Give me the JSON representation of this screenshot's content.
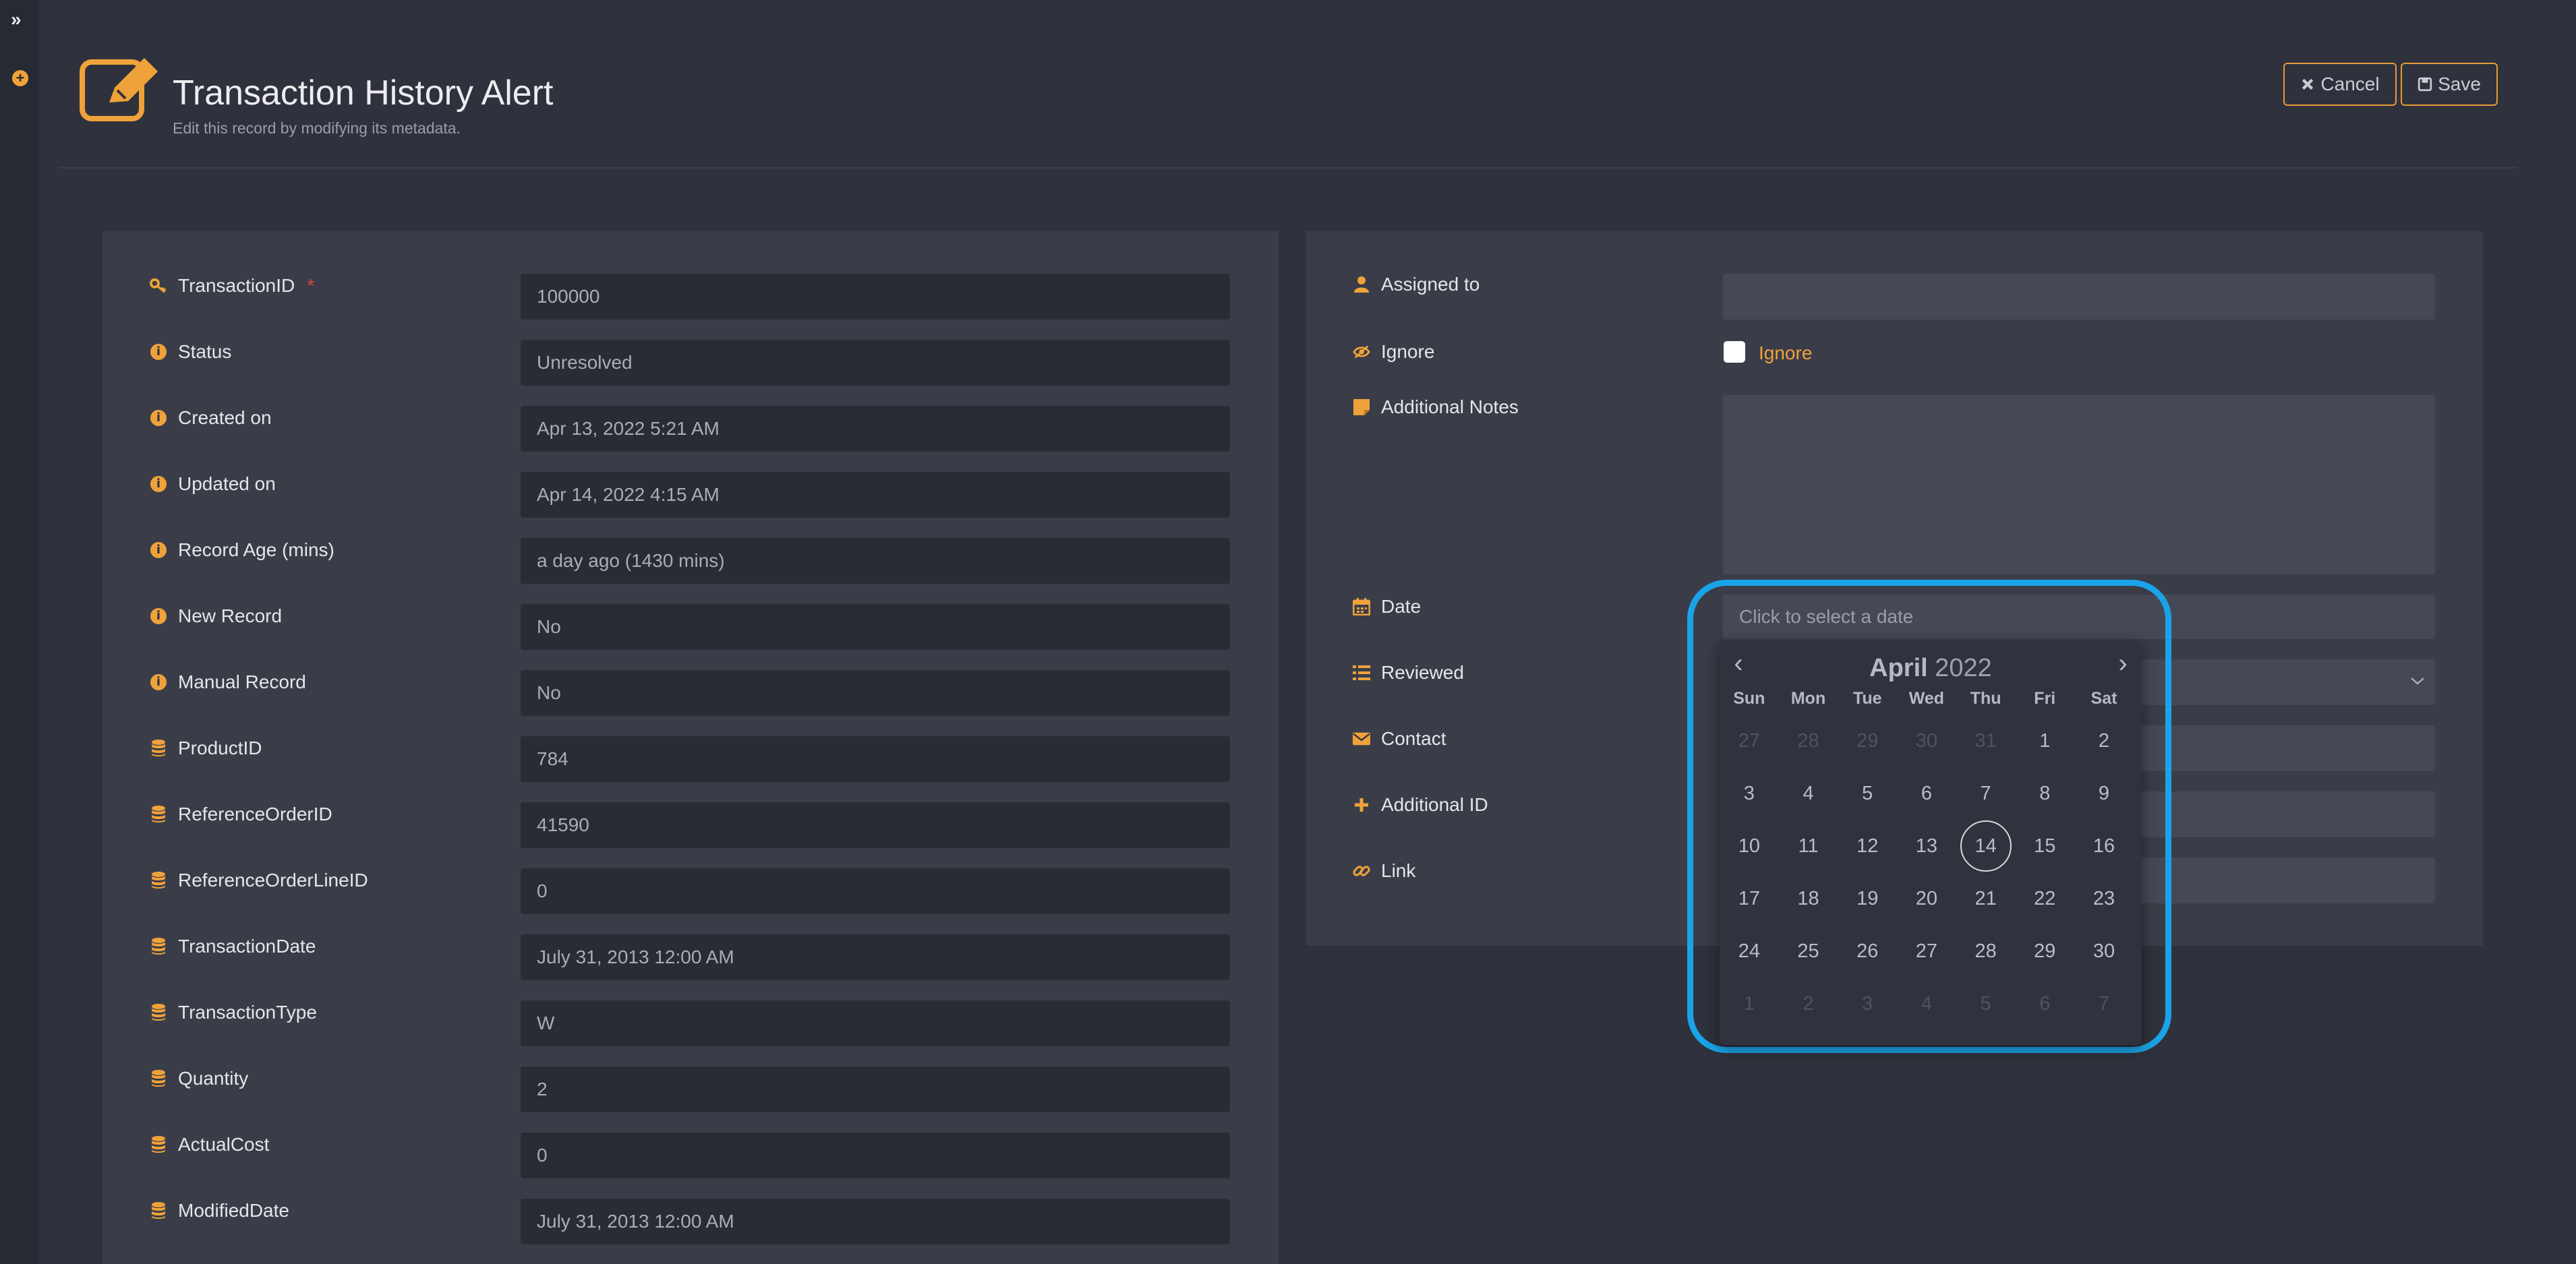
{
  "header": {
    "title": "Transaction History Alert",
    "subtitle": "Edit this record by modifying its metadata.",
    "cancel_label": "Cancel",
    "save_label": "Save"
  },
  "colors": {
    "accent": "#f0a23a",
    "highlight": "#1aa3e8",
    "background": "#2f323c",
    "panel": "#3a3d48"
  },
  "left_fields": [
    {
      "label": "TransactionID",
      "required": "*",
      "value": "100000",
      "icon": "key-icon"
    },
    {
      "label": "Status",
      "value": "Unresolved",
      "icon": "info-icon"
    },
    {
      "label": "Created on",
      "value": "Apr 13, 2022 5:21 AM",
      "icon": "info-icon"
    },
    {
      "label": "Updated on",
      "value": "Apr 14, 2022 4:15 AM",
      "icon": "info-icon"
    },
    {
      "label": "Record Age (mins)",
      "value": "a day ago (1430 mins)",
      "icon": "info-icon"
    },
    {
      "label": "New Record",
      "value": "No",
      "icon": "info-icon"
    },
    {
      "label": "Manual Record",
      "value": "No",
      "icon": "info-icon"
    },
    {
      "label": "ProductID",
      "value": "784",
      "icon": "database-icon"
    },
    {
      "label": "ReferenceOrderID",
      "value": "41590",
      "icon": "database-icon"
    },
    {
      "label": "ReferenceOrderLineID",
      "value": "0",
      "icon": "database-icon"
    },
    {
      "label": "TransactionDate",
      "value": "July 31, 2013 12:00 AM",
      "icon": "database-icon"
    },
    {
      "label": "TransactionType",
      "value": "W",
      "icon": "database-icon"
    },
    {
      "label": "Quantity",
      "value": "2",
      "icon": "database-icon"
    },
    {
      "label": "ActualCost",
      "value": "0",
      "icon": "database-icon"
    },
    {
      "label": "ModifiedDate",
      "value": "July 31, 2013 12:00 AM",
      "icon": "database-icon"
    }
  ],
  "right_fields": {
    "assigned_to": {
      "label": "Assigned to",
      "value": ""
    },
    "ignore": {
      "label": "Ignore",
      "checkbox_label": "Ignore"
    },
    "notes": {
      "label": "Additional Notes",
      "value": ""
    },
    "date": {
      "label": "Date",
      "placeholder": "Click to select a date"
    },
    "reviewed": {
      "label": "Reviewed"
    },
    "contact": {
      "label": "Contact"
    },
    "additional_id": {
      "label": "Additional ID"
    },
    "link": {
      "label": "Link"
    }
  },
  "calendar": {
    "month": "April",
    "year": "2022",
    "weekdays": [
      "Sun",
      "Mon",
      "Tue",
      "Wed",
      "Thu",
      "Fri",
      "Sat"
    ],
    "today": "14",
    "days": [
      {
        "d": "27",
        "muted": true
      },
      {
        "d": "28",
        "muted": true
      },
      {
        "d": "29",
        "muted": true
      },
      {
        "d": "30",
        "muted": true
      },
      {
        "d": "31",
        "muted": true
      },
      {
        "d": "1"
      },
      {
        "d": "2"
      },
      {
        "d": "3"
      },
      {
        "d": "4"
      },
      {
        "d": "5"
      },
      {
        "d": "6"
      },
      {
        "d": "7"
      },
      {
        "d": "8"
      },
      {
        "d": "9"
      },
      {
        "d": "10"
      },
      {
        "d": "11"
      },
      {
        "d": "12"
      },
      {
        "d": "13"
      },
      {
        "d": "14"
      },
      {
        "d": "15"
      },
      {
        "d": "16"
      },
      {
        "d": "17"
      },
      {
        "d": "18"
      },
      {
        "d": "19"
      },
      {
        "d": "20"
      },
      {
        "d": "21"
      },
      {
        "d": "22"
      },
      {
        "d": "23"
      },
      {
        "d": "24"
      },
      {
        "d": "25"
      },
      {
        "d": "26"
      },
      {
        "d": "27"
      },
      {
        "d": "28"
      },
      {
        "d": "29"
      },
      {
        "d": "30"
      },
      {
        "d": "1",
        "muted": true
      },
      {
        "d": "2",
        "muted": true
      },
      {
        "d": "3",
        "muted": true
      },
      {
        "d": "4",
        "muted": true
      },
      {
        "d": "5",
        "muted": true
      },
      {
        "d": "6",
        "muted": true
      },
      {
        "d": "7",
        "muted": true
      }
    ]
  }
}
